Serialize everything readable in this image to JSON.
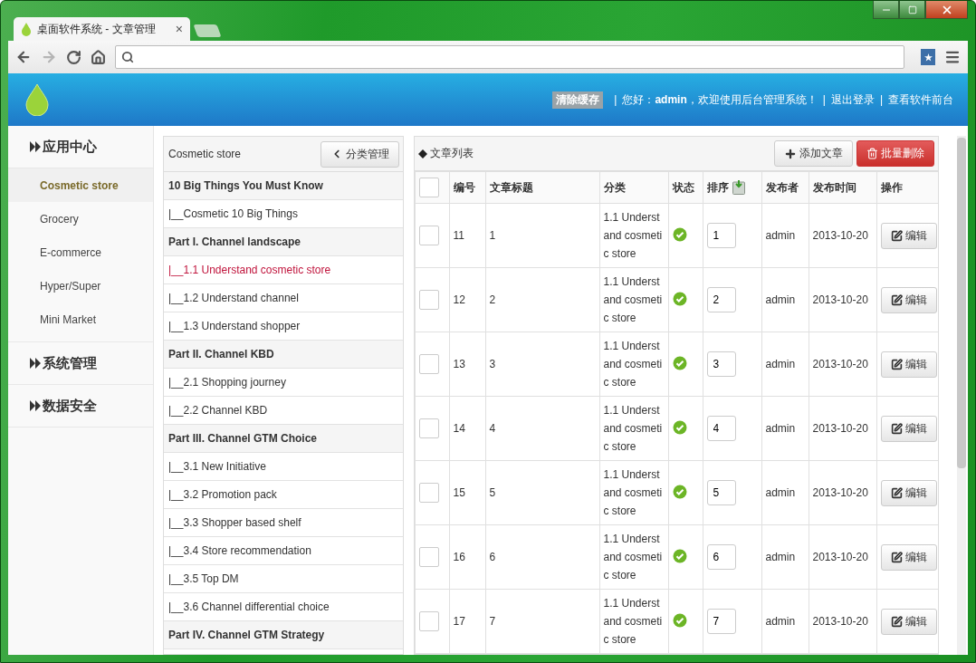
{
  "browser": {
    "tab_title": "桌面软件系统 - 文章管理",
    "tab_close": "×"
  },
  "header": {
    "clear_cache": "清除缓存",
    "separator": "|",
    "greeting": "您好：**admin**，欢迎使用后台管理系统！",
    "links": [
      "退出登录",
      "查看软件前台"
    ]
  },
  "sidebar": {
    "sections": [
      {
        "label": "应用中心",
        "items": [
          {
            "label": "Cosmetic store",
            "selected": true
          },
          {
            "label": "Grocery",
            "selected": false
          },
          {
            "label": "E-commerce",
            "selected": false
          },
          {
            "label": "Hyper/Super",
            "selected": false
          },
          {
            "label": "Mini Market",
            "selected": false
          }
        ]
      },
      {
        "label": "系统管理"
      },
      {
        "label": "数据安全"
      }
    ]
  },
  "categories": {
    "title": "Cosmetic store",
    "button": "分类管理",
    "rows": [
      {
        "kind": "group",
        "label": "10 Big Things You Must Know",
        "selected": false
      },
      {
        "kind": "item",
        "label": "|__Cosmetic 10 Big Things",
        "selected": false
      },
      {
        "kind": "group",
        "label": "Part I. Channel landscape",
        "selected": false
      },
      {
        "kind": "item",
        "label": "|__1.1 Understand cosmetic store",
        "selected": true
      },
      {
        "kind": "item",
        "label": "|__1.2 Understand channel",
        "selected": false
      },
      {
        "kind": "item",
        "label": "|__1.3 Understand shopper",
        "selected": false
      },
      {
        "kind": "group",
        "label": "Part II. Channel KBD",
        "selected": false
      },
      {
        "kind": "item",
        "label": "|__2.1 Shopping journey",
        "selected": false
      },
      {
        "kind": "item",
        "label": "|__2.2 Channel KBD",
        "selected": false
      },
      {
        "kind": "group",
        "label": "Part III. Channel GTM Choice",
        "selected": false
      },
      {
        "kind": "item",
        "label": "|__3.1 New Initiative",
        "selected": false
      },
      {
        "kind": "item",
        "label": "|__3.2 Promotion pack",
        "selected": false
      },
      {
        "kind": "item",
        "label": "|__3.3 Shopper based shelf",
        "selected": false
      },
      {
        "kind": "item",
        "label": "|__3.4 Store recommendation",
        "selected": false
      },
      {
        "kind": "item",
        "label": "|__3.5 Top DM",
        "selected": false
      },
      {
        "kind": "item",
        "label": "|__3.6 Channel differential choice",
        "selected": false
      },
      {
        "kind": "group",
        "label": "Part IV. Channel GTM Strategy",
        "selected": false
      }
    ]
  },
  "articles": {
    "title": "文章列表",
    "select_all_checked": false,
    "add_button": "添加文章",
    "delete_button": "批量删除",
    "columns": [
      "编号",
      "文章标题",
      "分类",
      "状态",
      "排序",
      "发布者",
      "发布时间",
      "操作"
    ],
    "rows": [
      {
        "checked": false,
        "id": "11",
        "title": "1",
        "category": "1.1 Understand cosmetic store",
        "published": true,
        "order": "1",
        "publisher": "admin",
        "date": "2013-10-20",
        "action": "编辑"
      },
      {
        "checked": false,
        "id": "12",
        "title": "2",
        "category": "1.1 Understand cosmetic store",
        "published": true,
        "order": "2",
        "publisher": "admin",
        "date": "2013-10-20",
        "action": "编辑"
      },
      {
        "checked": false,
        "id": "13",
        "title": "3",
        "category": "1.1 Understand cosmetic store",
        "published": true,
        "order": "3",
        "publisher": "admin",
        "date": "2013-10-20",
        "action": "编辑"
      },
      {
        "checked": false,
        "id": "14",
        "title": "4",
        "category": "1.1 Understand cosmetic store",
        "published": true,
        "order": "4",
        "publisher": "admin",
        "date": "2013-10-20",
        "action": "编辑"
      },
      {
        "checked": false,
        "id": "15",
        "title": "5",
        "category": "1.1 Understand cosmetic store",
        "published": true,
        "order": "5",
        "publisher": "admin",
        "date": "2013-10-20",
        "action": "编辑"
      },
      {
        "checked": false,
        "id": "16",
        "title": "6",
        "category": "1.1 Understand cosmetic store",
        "published": true,
        "order": "6",
        "publisher": "admin",
        "date": "2013-10-20",
        "action": "编辑"
      },
      {
        "checked": false,
        "id": "17",
        "title": "7",
        "category": "1.1 Understand cosmetic store",
        "published": true,
        "order": "7",
        "publisher": "admin",
        "date": "2013-10-20",
        "action": "编辑"
      }
    ]
  }
}
